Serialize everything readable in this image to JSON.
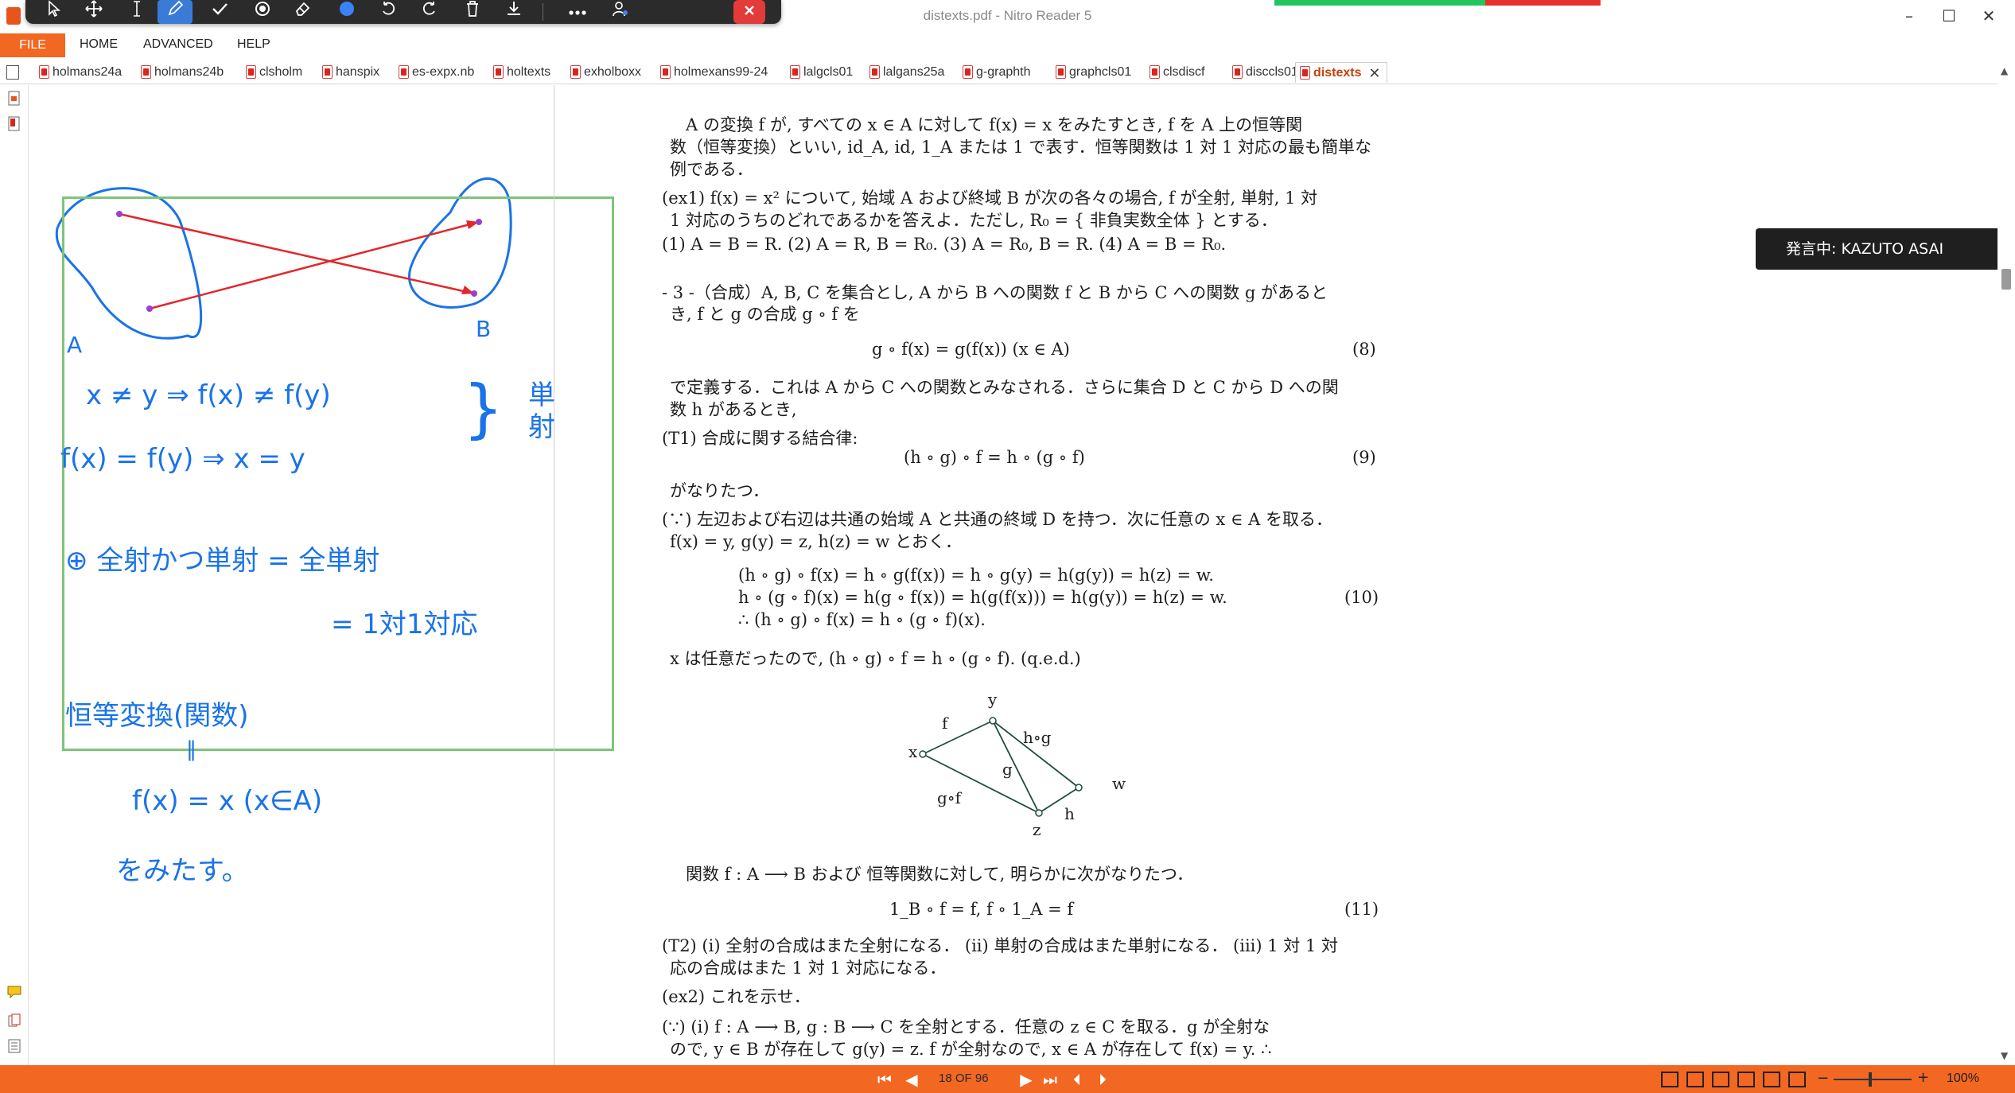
{
  "window": {
    "title": "distexts.pdf - Nitro Reader 5",
    "minimize": "–",
    "maximize": "☐",
    "close": "✕"
  },
  "ribbon": {
    "file": "FILE",
    "tabs": [
      "HOME",
      "ADVANCED",
      "HELP"
    ]
  },
  "tabs": [
    "holmans24a",
    "holmans24b",
    "clsholm",
    "hanspix",
    "es-expx.nb",
    "holtexts",
    "exholboxx",
    "holmexans99-24",
    "lalgcls01",
    "lalgans25a",
    "g-graphth",
    "graphcls01",
    "clsdiscf",
    "disccls01",
    "distexts"
  ],
  "active_tab": "distexts",
  "speaking_badge": "発言中: KAZUTO ASAI",
  "colors": {
    "accent": "#f26722",
    "ink": "#1a73e8",
    "arrow": "#e3262b",
    "frame": "#7dc47a"
  },
  "handwriting": {
    "label_a": "A",
    "label_b": "B",
    "injective_def1": "x ≠ y ⇒ f(x) ≠ f(y)",
    "injective_def2": "f(x) = f(y) ⇒ x = y",
    "brace": "}",
    "injective_label": "単\n射",
    "bijective1": "⊕ 全射かつ単射 = 全単射",
    "bijective2": "= 1対1対応",
    "identity1": "恒等変換(関数)",
    "identity2": "‖",
    "identity3": "f(x) = x   (x∈A)",
    "identity4": "をみたす。"
  },
  "document": {
    "p1": [
      "A の変換 f が, すべての x ∈ A に対して f(x) = x をみたすとき, f を A 上の恒等関",
      "数（恒等変換）といい, id_A, id, 1_A または 1 で表す．恒等関数は 1 対 1 対応の最も簡単な",
      "例である．"
    ],
    "ex1": [
      "(ex1)  f(x) = x² について, 始域 A および終域 B が次の各々の場合, f が全射, 単射, 1 対",
      "1 対応のうちのどれであるかを答えよ．ただし, R₀ = { 非負実数全体 } とする．",
      "(1)  A = B = R.   (2)  A = R, B = R₀.   (3)  A = R₀, B = R.   (4)  A = B = R₀."
    ],
    "sec3": [
      "- 3 -（合成）A, B, C を集合とし, A から B への関数 f と B から C への関数 g があると",
      "き, f と g の合成 g ∘ f を"
    ],
    "eq8": "g ∘ f(x) = g(f(x))        (x ∈ A)",
    "eq8_num": "(8)",
    "after8": [
      "で定義する．これは A から C への関数とみなされる．さらに集合 D と C から D への関",
      "数 h があるとき,"
    ],
    "t1": "(T1)  合成に関する結合律:",
    "eq9": "(h ∘ g) ∘ f = h ∘ (g ∘ f)",
    "eq9_num": "(9)",
    "after9": "がなりたつ．",
    "proof1": [
      "(∵)  左辺および右辺は共通の始域 A と共通の終域 D を持つ．次に任意の x ∈ A を取る．",
      "f(x) = y, g(y) = z, h(z) = w とおく．"
    ],
    "eq10": [
      "(h ∘ g) ∘ f(x) = h ∘ g(f(x)) = h ∘ g(y) = h(g(y)) = h(z) = w.",
      "h ∘ (g ∘ f)(x) = h(g ∘ f(x)) = h(g(f(x))) = h(g(y)) = h(z) = w.",
      "∴  (h ∘ g) ∘ f(x) = h ∘ (g ∘ f)(x)."
    ],
    "eq10_num": "(10)",
    "qed": "x は任意だったので, (h ∘ g) ∘ f = h ∘ (g ∘ f).   (q.e.d.)",
    "diagram": {
      "x": "x",
      "y": "y",
      "z": "z",
      "w": "w",
      "f": "f",
      "g": "g",
      "h": "h",
      "hog": "h∘g",
      "gof": "g∘f"
    },
    "identity_intro": "関数 f : A ⟶ B および 恒等関数に対して, 明らかに次がなりたつ．",
    "eq11": "1_B ∘ f = f,        f ∘ 1_A = f",
    "eq11_num": "(11)",
    "t2": [
      "(T2)  (i)  全射の合成はまた全射になる．  (ii)  単射の合成はまた単射になる．  (iii)  1 対 1 対",
      "応の合成はまた 1 対 1 対応になる．"
    ],
    "ex2": "(ex2)  これを示せ．",
    "proof2": [
      "(∵)  (i)  f : A ⟶ B, g : B ⟶ C を全射とする．任意の z ∈ C を取る．g が全射な",
      "ので, y ∈ B が存在して g(y) = z. f が全射なので, x ∈ A が存在して f(x) = y.   ∴"
    ]
  },
  "status": {
    "page_indicator": "18 OF 96",
    "zoom": "100%"
  }
}
